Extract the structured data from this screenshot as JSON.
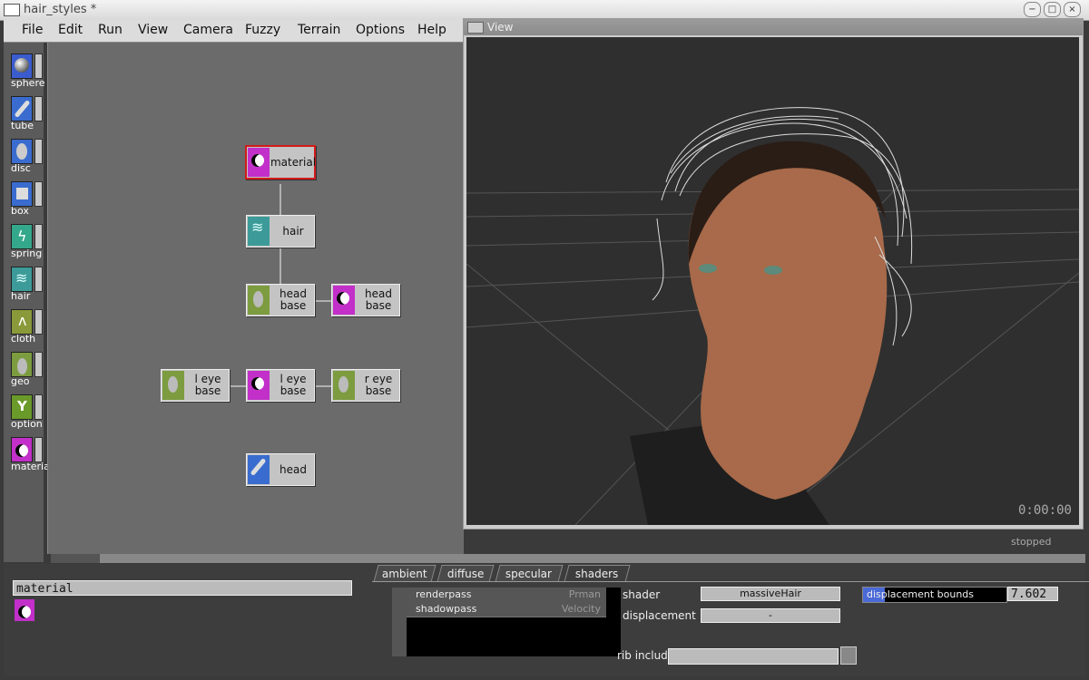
{
  "window": {
    "title": "hair_styles *"
  },
  "menu": [
    "File",
    "Edit",
    "Run",
    "View",
    "Camera",
    "Fuzzy",
    "Terrain",
    "Options",
    "Help"
  ],
  "palette": [
    {
      "label": "sphere",
      "icon": "sphere-icon"
    },
    {
      "label": "tube",
      "icon": "tube-icon"
    },
    {
      "label": "disc",
      "icon": "disc-icon"
    },
    {
      "label": "box",
      "icon": "box-icon"
    },
    {
      "label": "spring",
      "icon": "spring-icon"
    },
    {
      "label": "hair",
      "icon": "hair-icon"
    },
    {
      "label": "cloth",
      "icon": "cloth-icon"
    },
    {
      "label": "geo",
      "icon": "geo-icon"
    },
    {
      "label": "option",
      "icon": "option-icon"
    },
    {
      "label": "materia",
      "icon": "material-icon"
    }
  ],
  "graph": {
    "nodes": [
      {
        "label": "material",
        "icon": "material-icon",
        "selected": true
      },
      {
        "label": "hair",
        "icon": "hair-icon"
      },
      {
        "label": "head\nbase",
        "icon": "geo-icon"
      },
      {
        "label": "head\nbase",
        "icon": "material-icon"
      },
      {
        "label": "l eye\nbase",
        "icon": "geo-icon"
      },
      {
        "label": "l eye\nbase",
        "icon": "material-icon"
      },
      {
        "label": "r eye\nbase",
        "icon": "geo-icon"
      },
      {
        "label": "head",
        "icon": "tube-icon"
      }
    ]
  },
  "view": {
    "title": "View",
    "timecode": "0:00:00",
    "status": "stopped"
  },
  "inspector": {
    "node_name": "material",
    "tabs": [
      "ambient",
      "diffuse",
      "specular",
      "shaders"
    ],
    "active_tab": "shaders",
    "passes": [
      {
        "name": "renderpass",
        "value": "Prman"
      },
      {
        "name": "shadowpass",
        "value": "Velocity"
      }
    ],
    "shader_label": "shader",
    "shader_value": "massiveHair",
    "displacement_label": "displacement",
    "displacement_value": "-",
    "displacement_bounds_label": "displacement bounds",
    "displacement_bounds_fraction": 0.15,
    "displacement_bounds_value": "7.602",
    "rib_include_label": "rib include",
    "rib_include_value": ""
  },
  "colors": {
    "selected_border": "#d31a1a",
    "material_icon": "#c22fc9",
    "hair_icon": "#3c9b98",
    "geo_icon": "#7c9c3f",
    "tube_icon": "#3a6ccf"
  }
}
